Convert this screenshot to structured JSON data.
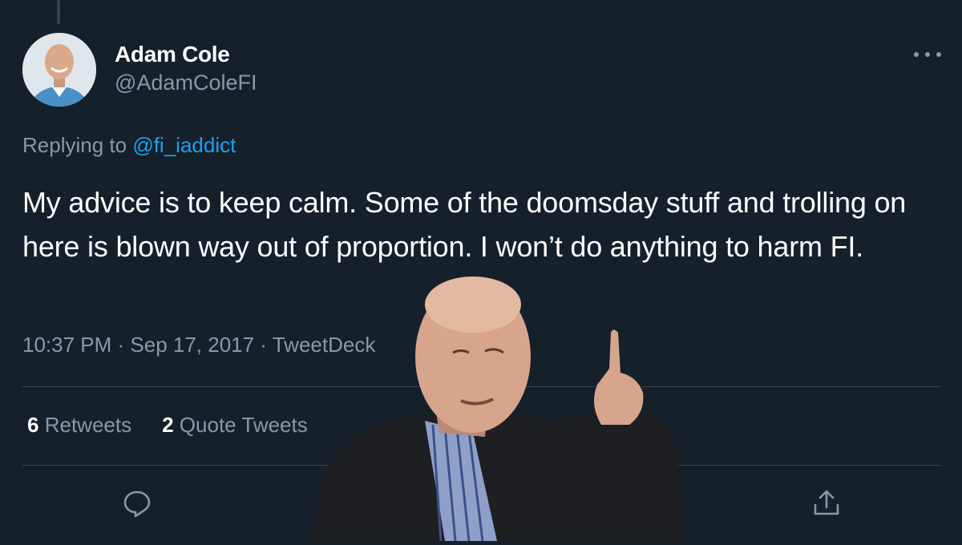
{
  "tweet": {
    "author": {
      "display_name": "Adam Cole",
      "handle": "@AdamColeFI"
    },
    "replying_prefix": "Replying to",
    "replying_to": "@fi_iaddict",
    "text": "My advice is to keep calm. Some of the doomsday stuff and trolling on here is blown way out of proportion. I won’t do anything to harm FI.",
    "timestamp": "10:37 PM · Sep 17, 2017 · TweetDeck",
    "stats": {
      "retweets_count": "6",
      "retweets_label": "Retweets",
      "quote_count": "2",
      "quote_label": "Quote Tweets"
    }
  },
  "icons": {
    "more": "more-dots-icon",
    "reply": "reply-icon",
    "like": "like-icon",
    "share": "share-icon"
  },
  "colors": {
    "background": "#15202b",
    "secondary_text": "#8899a6",
    "mention": "#1da1f2",
    "divider": "#38444d"
  }
}
